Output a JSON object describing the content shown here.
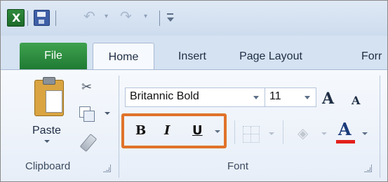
{
  "qat": {
    "app_icon": "excel-logo",
    "app_letter": "X",
    "undo_icon": "undo-icon",
    "undo_glyph": "↶",
    "redo_icon": "redo-icon",
    "redo_glyph": "↷",
    "caret_glyph": "▾"
  },
  "tabs": {
    "file": "File",
    "home": "Home",
    "insert": "Insert",
    "page_layout": "Page Layout",
    "formulas_partial": "Forr"
  },
  "clipboard": {
    "paste_label": "Paste",
    "group_label": "Clipboard",
    "cut_glyph": "✂"
  },
  "font": {
    "font_name": "Britannic Bold",
    "font_size": "11",
    "grow_glyph": "A",
    "shrink_glyph": "A",
    "bold": "B",
    "italic": "I",
    "underline": "U",
    "fill_glyph": "◈",
    "color_glyph": "A",
    "font_color": "#e3201b",
    "group_label": "Font",
    "highlight_color": "#e0732a"
  }
}
